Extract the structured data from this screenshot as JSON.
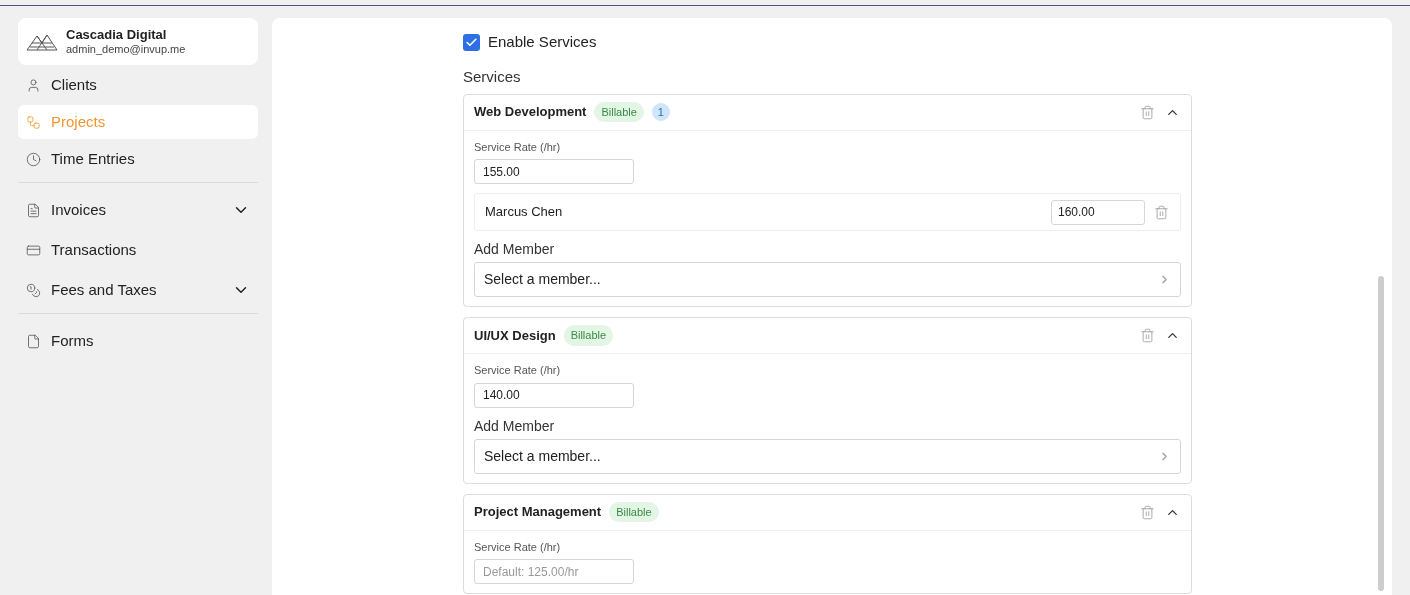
{
  "account": {
    "name": "Cascadia Digital",
    "email": "admin_demo@invup.me"
  },
  "sidebar": {
    "groups": [
      [
        {
          "label": "Clients",
          "selected": false
        },
        {
          "label": "Projects",
          "selected": true
        },
        {
          "label": "Time Entries",
          "selected": false
        }
      ],
      [
        {
          "label": "Invoices",
          "selected": false,
          "expandable": true
        },
        {
          "label": "Transactions",
          "selected": false
        },
        {
          "label": "Fees and Taxes",
          "selected": false,
          "expandable": true
        }
      ],
      [
        {
          "label": "Forms",
          "selected": false
        }
      ]
    ]
  },
  "enable_services": {
    "label": "Enable Services",
    "checked": true
  },
  "services_label": "Services",
  "services": [
    {
      "name": "Web Development",
      "badge": "Billable",
      "count": "1",
      "expanded": true,
      "rate_label": "Service Rate (/hr)",
      "rate": "155.00",
      "members": [
        {
          "name": "Marcus Chen",
          "rate": "160.00"
        }
      ],
      "add_member_label": "Add Member",
      "member_placeholder": "Select a member..."
    },
    {
      "name": "UI/UX Design",
      "badge": "Billable",
      "expanded": true,
      "rate_label": "Service Rate (/hr)",
      "rate": "140.00",
      "add_member_label": "Add Member",
      "member_placeholder": "Select a member..."
    },
    {
      "name": "Project Management",
      "badge": "Billable",
      "expanded": true,
      "rate_label": "Service Rate (/hr)",
      "rate_placeholder": "Default: 125.00/hr"
    }
  ]
}
